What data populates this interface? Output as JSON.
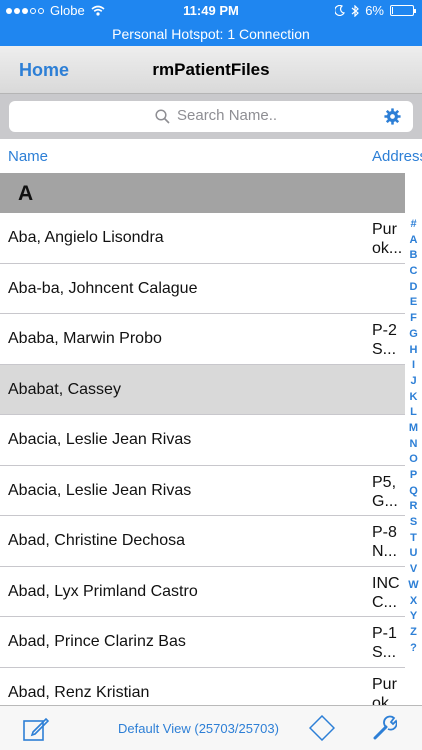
{
  "status_bar": {
    "carrier": "Globe",
    "time": "11:49 PM",
    "battery": "6%",
    "battery_level": 0.06
  },
  "hotspot_banner": "Personal Hotspot: 1 Connection",
  "nav": {
    "back_label": "Home",
    "title": "rmPatientFiles"
  },
  "search": {
    "placeholder": "Search Name.."
  },
  "columns": {
    "name": "Name",
    "address": "Address"
  },
  "section_header": "A",
  "rows": [
    {
      "name": "Aba, Angielo Lisondra",
      "address": "Pur\nok..."
    },
    {
      "name": "Aba-ba, Johncent Calague",
      "address": ""
    },
    {
      "name": "Ababa, Marwin Probo",
      "address": "P-2\nS..."
    },
    {
      "name": "Ababat, Cassey",
      "address": ""
    },
    {
      "name": "Abacia, Leslie Jean Rivas",
      "address": ""
    },
    {
      "name": "Abacia, Leslie Jean Rivas",
      "address": "P5,\nG..."
    },
    {
      "name": "Abad, Christine Dechosa",
      "address": "P-8\nN..."
    },
    {
      "name": "Abad, Lyx Primland Castro",
      "address": "INC\nC..."
    },
    {
      "name": "Abad, Prince Clarinz Bas",
      "address": "P-1\nS..."
    },
    {
      "name": "Abad, Renz Kristian",
      "address": "Pur\nok..."
    }
  ],
  "selected_row": 3,
  "index_letters": [
    "#",
    "A",
    "B",
    "C",
    "D",
    "E",
    "F",
    "G",
    "H",
    "I",
    "J",
    "K",
    "L",
    "M",
    "N",
    "O",
    "P",
    "Q",
    "R",
    "S",
    "T",
    "U",
    "V",
    "W",
    "X",
    "Y",
    "Z",
    "?"
  ],
  "toolbar": {
    "view_label": "Default View",
    "record_count": "(25703/25703)"
  },
  "colors": {
    "status_blue": "#1f86f0",
    "accent_blue": "#2d7fd6",
    "section_gray": "#a3a3a3",
    "selected_gray": "#d9d9d9"
  },
  "icons": [
    "wifi-icon",
    "moon-icon",
    "bluetooth-icon",
    "battery-icon",
    "search-icon",
    "gear-icon",
    "compose-icon",
    "diamond-icon",
    "wrench-icon"
  ]
}
